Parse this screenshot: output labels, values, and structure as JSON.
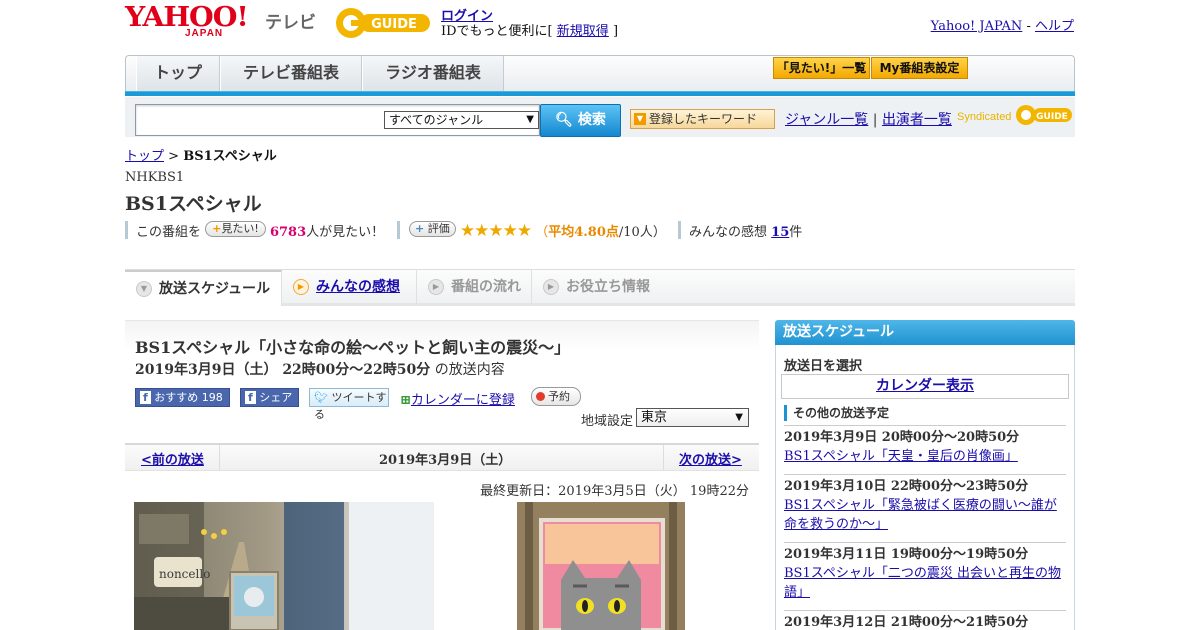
{
  "header": {
    "logo_text": "YAHOO!",
    "logo_sub": "JAPAN",
    "tv_label": "テレビ",
    "gguide_logo_text": "G GUIDE",
    "login_link": "ログイン",
    "promo_prefix": "IDでもっと便利に[",
    "promo_link": "新規取得",
    "promo_suffix": "]",
    "yahoo_japan_link": "Yahoo! JAPAN",
    "separator": "-",
    "help_link": "ヘルプ"
  },
  "nav": {
    "tabs": [
      "トップ",
      "テレビ番組表",
      "ラジオ番組表"
    ],
    "mitai_list_btn": "「見たい!」一覧",
    "my_schedule_btn": "My番組表設定"
  },
  "search": {
    "genre_value": "すべてのジャンル",
    "search_button": "検索",
    "keyword_button": "登録したキーワード",
    "genre_list_link": "ジャンル一覧",
    "divider": "|",
    "performer_link": "出演者一覧",
    "syndicated": "Syndicated"
  },
  "breadcrumb": {
    "top": "トップ",
    "sep": ">",
    "current": "BS1スペシャル"
  },
  "program": {
    "channel": "NHKBS1",
    "title": "BS1スペシャル",
    "mitai_prefix": "この番組を",
    "mitai_badge": "見たい!",
    "mitai_count": "6783",
    "mitai_suffix": "人が見たい！",
    "rating_badge": "評価",
    "stars": "★★★★★",
    "avg_prefix": "（",
    "avg_text": "平均4.80点",
    "avg_suffix": "/10人）",
    "reviews_prefix": "みんなの感想",
    "reviews_count": "15",
    "reviews_suffix": "件",
    "rating_value": 4.8
  },
  "content_tabs": [
    {
      "label": "放送スケジュール"
    },
    {
      "label": "みんなの感想"
    },
    {
      "label": "番組の流れ"
    },
    {
      "label": "お役立ち情報"
    }
  ],
  "broadcast": {
    "title": "BS1スペシャル「小さな命の絵～ペットと飼い主の震災～」",
    "time": "2019年3月9日（土） 22時00分～22時50分",
    "time_suffix": "の放送内容",
    "fb_recommend": "おすすめ 198",
    "fb_share": "シェア",
    "tweet": "ツイートする",
    "calendar_register": "カレンダーに登録",
    "reserve": "予約",
    "region_label": "地域設定",
    "region_value": "東京"
  },
  "date_nav": {
    "prev": "<前の放送",
    "current": "2019年3月9日（土）",
    "next": "次の放送>",
    "updated": "最終更新日：2019年3月5日（火） 19時22分"
  },
  "sidebar": {
    "heading": "放送スケジュール",
    "date_select_label": "放送日を選択",
    "calendar_button": "カレンダー表示",
    "other_heading": "その他の放送予定",
    "schedules": [
      {
        "datetime": "2019年3月9日 20時00分～20時50分",
        "title": "BS1スペシャル「天皇・皇后の肖像画」"
      },
      {
        "datetime": "2019年3月10日 22時00分～23時50分",
        "title": "BS1スペシャル「緊急被ばく医療の闘い～誰が命を救うのか～」"
      },
      {
        "datetime": "2019年3月11日 19時00分～19時50分",
        "title": "BS1スペシャル「二つの震災 出会いと再生の物語」"
      },
      {
        "datetime": "2019年3月12日 21時00分～21時50分",
        "title": ""
      }
    ]
  },
  "colors": {
    "yahoo_red": "#e0001a",
    "accent_blue": "#1a9ad6",
    "link": "#1a0dab",
    "pink_count": "#d6006e",
    "star_orange": "#f0a800"
  }
}
